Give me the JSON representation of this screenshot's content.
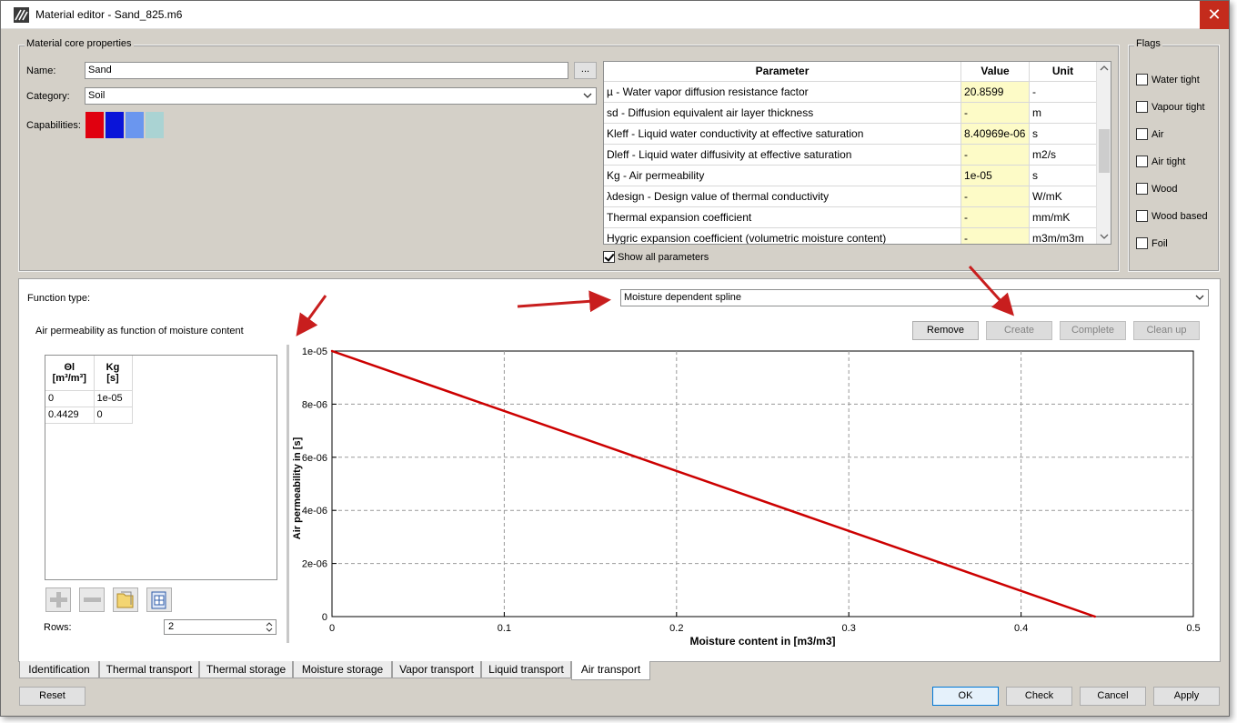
{
  "window": {
    "title": "Material editor - Sand_825.m6",
    "close_glyph": "✕"
  },
  "core": {
    "group_title": "Material core properties",
    "name_label": "Name:",
    "name_value": "Sand",
    "browse_label": "...",
    "category_label": "Category:",
    "category_value": "Soil",
    "capabilities_label": "Capabilities:",
    "capability_colors": [
      "#e0000f",
      "#0a14d9",
      "#6a96ef",
      "#aad3d3"
    ]
  },
  "params": {
    "headers": [
      "Parameter",
      "Value",
      "Unit"
    ],
    "rows": [
      {
        "param": "µ - Water vapor diffusion resistance factor",
        "value": "20.8599",
        "unit": "-"
      },
      {
        "param": "sd - Diffusion equivalent air layer thickness",
        "value": "-",
        "unit": "m"
      },
      {
        "param": "Kleff - Liquid water conductivity at effective saturation",
        "value": "8.40969e-06",
        "unit": "s"
      },
      {
        "param": "Dleff - Liquid water diffusivity at effective saturation",
        "value": "-",
        "unit": "m2/s"
      },
      {
        "param": "Kg - Air permeability",
        "value": "1e-05",
        "unit": "s"
      },
      {
        "param": "λdesign - Design value of thermal conductivity",
        "value": "-",
        "unit": "W/mK"
      },
      {
        "param": "Thermal expansion coefficient",
        "value": "-",
        "unit": "mm/mK"
      },
      {
        "param": "Hygric expansion coefficient (volumetric moisture content)",
        "value": "-",
        "unit": "m3m/m3m"
      }
    ],
    "show_all_label": "Show all parameters",
    "show_all_checked": true
  },
  "flags": {
    "group_title": "Flags",
    "items": [
      "Water tight",
      "Vapour tight",
      "Air",
      "Air tight",
      "Wood",
      "Wood based",
      "Foil"
    ]
  },
  "function": {
    "type_label": "Function type:",
    "type_value": "Moisture dependent spline",
    "subtitle": "Air permeability as function of moisture content",
    "buttons": {
      "remove": "Remove",
      "create": "Create",
      "complete": "Complete",
      "cleanup": "Clean up"
    }
  },
  "spline_table": {
    "col1_name": "Θl",
    "col1_unit": "[m³/m³]",
    "col2_name": "Kg",
    "col2_unit": "[s]",
    "rows": [
      [
        "0",
        "1e-05"
      ],
      [
        "0.4429",
        "0"
      ]
    ],
    "rows_label": "Rows:",
    "rows_value": "2"
  },
  "chart_data": {
    "type": "line",
    "title": "",
    "xlabel": "Moisture content in [m3/m3]",
    "ylabel": "Air permeability in [s]",
    "xlim": [
      0,
      0.5
    ],
    "ylim": [
      0,
      1e-05
    ],
    "xticks": [
      "0",
      "0.1",
      "0.2",
      "0.3",
      "0.4",
      "0.5"
    ],
    "yticks": [
      "0",
      "2e-06",
      "4e-06",
      "6e-06",
      "8e-06",
      "1e-05"
    ],
    "grid": true,
    "series": [
      {
        "x": [
          0,
          0.4429
        ],
        "y": [
          1e-05,
          0
        ]
      }
    ],
    "line_color": "#cc0000"
  },
  "tabs": [
    "Identification",
    "Thermal transport",
    "Thermal storage",
    "Moisture storage",
    "Vapor transport",
    "Liquid transport",
    "Air transport"
  ],
  "active_tab": "Air transport",
  "footer": {
    "reset": "Reset",
    "ok": "OK",
    "check": "Check",
    "cancel": "Cancel",
    "apply": "Apply"
  }
}
